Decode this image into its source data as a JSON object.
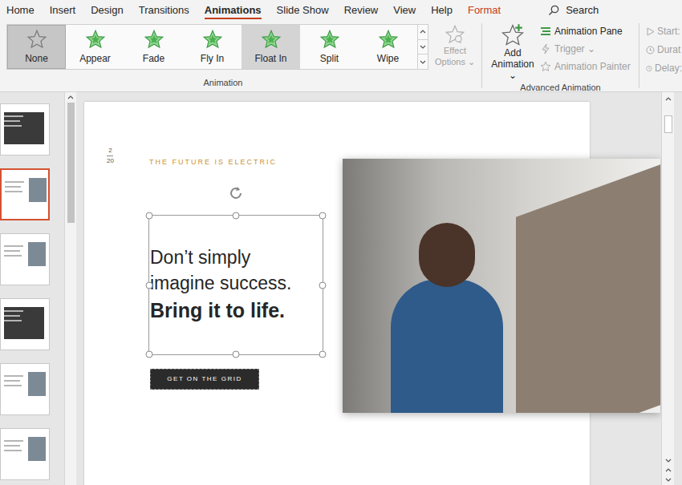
{
  "ribbon": {
    "tabs": [
      {
        "label": "Home",
        "selected": false,
        "contextual": false
      },
      {
        "label": "Insert",
        "selected": false,
        "contextual": false
      },
      {
        "label": "Design",
        "selected": false,
        "contextual": false
      },
      {
        "label": "Transitions",
        "selected": false,
        "contextual": false
      },
      {
        "label": "Animations",
        "selected": true,
        "contextual": false
      },
      {
        "label": "Slide Show",
        "selected": false,
        "contextual": false
      },
      {
        "label": "Review",
        "selected": false,
        "contextual": false
      },
      {
        "label": "View",
        "selected": false,
        "contextual": false
      },
      {
        "label": "Help",
        "selected": false,
        "contextual": false
      },
      {
        "label": "Format",
        "selected": false,
        "contextual": true
      }
    ],
    "search": "Search"
  },
  "animation_group": {
    "label": "Animation",
    "items": [
      {
        "label": "None",
        "kind": "none",
        "selected": true,
        "hovered": false
      },
      {
        "label": "Appear",
        "kind": "effect",
        "selected": false,
        "hovered": false
      },
      {
        "label": "Fade",
        "kind": "effect",
        "selected": false,
        "hovered": false
      },
      {
        "label": "Fly In",
        "kind": "effect",
        "selected": false,
        "hovered": false
      },
      {
        "label": "Float In",
        "kind": "effect",
        "selected": false,
        "hovered": true
      },
      {
        "label": "Split",
        "kind": "effect",
        "selected": false,
        "hovered": false
      },
      {
        "label": "Wipe",
        "kind": "effect",
        "selected": false,
        "hovered": false
      }
    ],
    "effect_options": {
      "label": "Effect Options",
      "disabled": true
    }
  },
  "advanced_group": {
    "label": "Advanced Animation",
    "add_animation": "Add Animation",
    "items": [
      {
        "label": "Animation Pane",
        "disabled": false
      },
      {
        "label": "Trigger",
        "disabled": true
      },
      {
        "label": "Animation Painter",
        "disabled": true
      }
    ]
  },
  "timing_group": {
    "items": [
      {
        "label": "Start:",
        "disabled": true
      },
      {
        "label": "Durat",
        "disabled": true
      },
      {
        "label": "Delay:",
        "disabled": true
      }
    ]
  },
  "thumbnails": [
    {
      "selected": false
    },
    {
      "selected": true
    },
    {
      "selected": false
    },
    {
      "selected": false
    },
    {
      "selected": false
    },
    {
      "selected": false
    }
  ],
  "slide": {
    "page": "2",
    "total": "20",
    "eyebrow": "THE FUTURE IS ELECTRIC",
    "textbox_selected": true,
    "lines": [
      {
        "text": "Don’t simply",
        "bold": false
      },
      {
        "text": "imagine success.",
        "bold": false
      },
      {
        "text": "Bring it to life.",
        "bold": true
      }
    ],
    "button": "GET ON THE GRID"
  }
}
